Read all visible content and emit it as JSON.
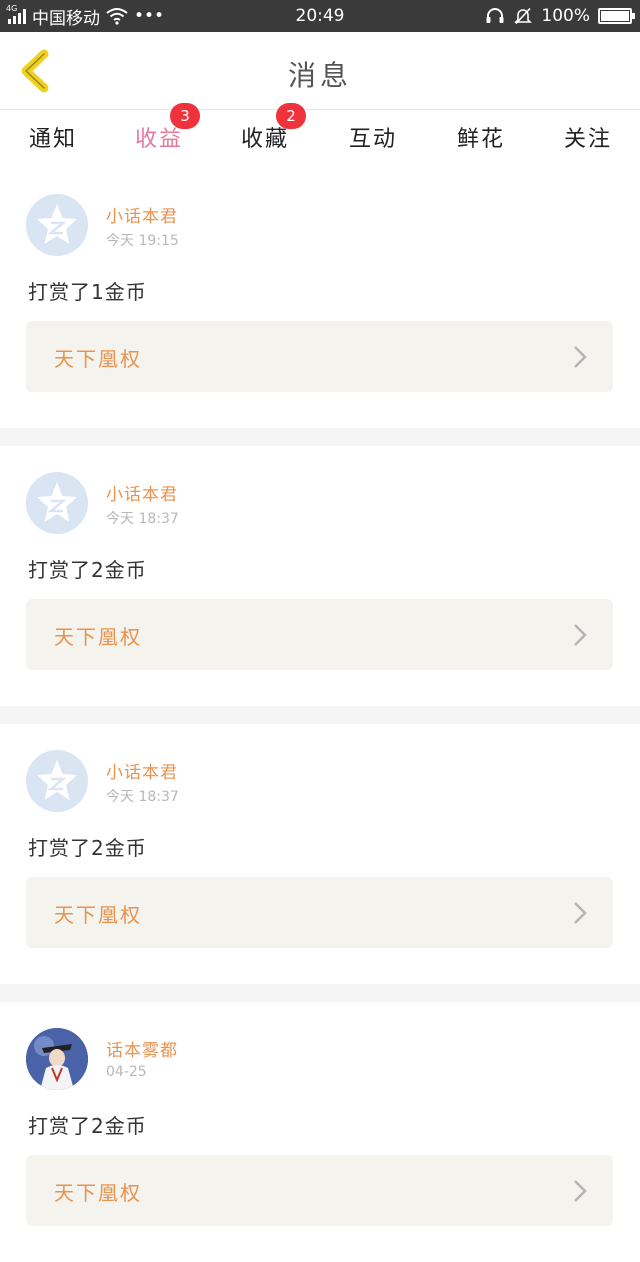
{
  "status_bar": {
    "network": "4G",
    "carrier": "中国移动",
    "more": "•••",
    "time": "20:49",
    "battery": "100%"
  },
  "header": {
    "title": "消息",
    "back_icon": "chevron-left-icon",
    "accent_color": "#f0d020"
  },
  "tabs": [
    {
      "label": "通知",
      "badge": ""
    },
    {
      "label": "收益",
      "badge": "3",
      "active": true
    },
    {
      "label": "收藏",
      "badge": "2"
    },
    {
      "label": "互动",
      "badge": ""
    },
    {
      "label": "鲜花",
      "badge": ""
    },
    {
      "label": "关注",
      "badge": ""
    }
  ],
  "colors": {
    "active_tab": "#e8789a",
    "badge": "#f0323c",
    "username": "#e8934f",
    "book_bg": "#f4f3ee"
  },
  "feed": [
    {
      "username": "小话本君",
      "time": "今天 19:15",
      "message": "打赏了1金币",
      "book": "天下凰权",
      "avatar": "qzone-star-avatar"
    },
    {
      "username": "小话本君",
      "time": "今天 18:37",
      "message": "打赏了2金币",
      "book": "天下凰权",
      "avatar": "qzone-star-avatar"
    },
    {
      "username": "小话本君",
      "time": "今天 18:37",
      "message": "打赏了2金币",
      "book": "天下凰权",
      "avatar": "qzone-star-avatar"
    },
    {
      "username": "话本雾都",
      "time": "04-25",
      "message": "打赏了2金币",
      "book": "天下凰权",
      "avatar": "photo-avatar"
    }
  ]
}
